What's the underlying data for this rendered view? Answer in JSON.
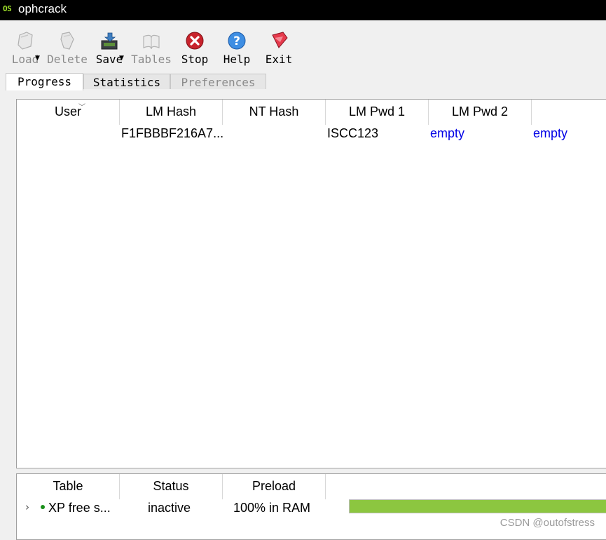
{
  "window": {
    "logo_text": "OS",
    "title": "ophcrack"
  },
  "toolbar": {
    "buttons": [
      {
        "label": "Load",
        "icon": "load-icon",
        "enabled": false
      },
      {
        "label": "Delete",
        "icon": "delete-icon",
        "enabled": false
      },
      {
        "label": "Save",
        "icon": "save-icon",
        "enabled": true
      },
      {
        "label": "Tables",
        "icon": "tables-icon",
        "enabled": false
      },
      {
        "label": "Stop",
        "icon": "stop-icon",
        "enabled": true
      },
      {
        "label": "Help",
        "icon": "help-icon",
        "enabled": true
      },
      {
        "label": "Exit",
        "icon": "exit-icon",
        "enabled": true
      }
    ]
  },
  "tabs": [
    {
      "label": "Progress",
      "active": true
    },
    {
      "label": "Statistics",
      "active": false
    },
    {
      "label": "Preferences",
      "active": false,
      "disabled": true
    }
  ],
  "hash_table": {
    "columns": [
      "User",
      "LM Hash",
      "NT Hash",
      "LM Pwd 1",
      "LM Pwd 2"
    ],
    "rows": [
      {
        "user": "",
        "lm_hash": "F1FBBBF216A7...",
        "nt_hash": "",
        "lm_pwd1": "ISCC123",
        "lm_pwd2": "empty",
        "nt_pwd": "empty"
      }
    ]
  },
  "tables_panel": {
    "columns": [
      "Table",
      "Status",
      "Preload"
    ],
    "rows": [
      {
        "table": "XP free s...",
        "status": "inactive",
        "preload": "100% in RAM",
        "progress": 1.0
      }
    ]
  },
  "colors": {
    "accent_green": "#8cc640",
    "empty_blue": "#0000e6",
    "active_dot": "#1a8f1a"
  },
  "watermark": "CSDN @outofstress"
}
